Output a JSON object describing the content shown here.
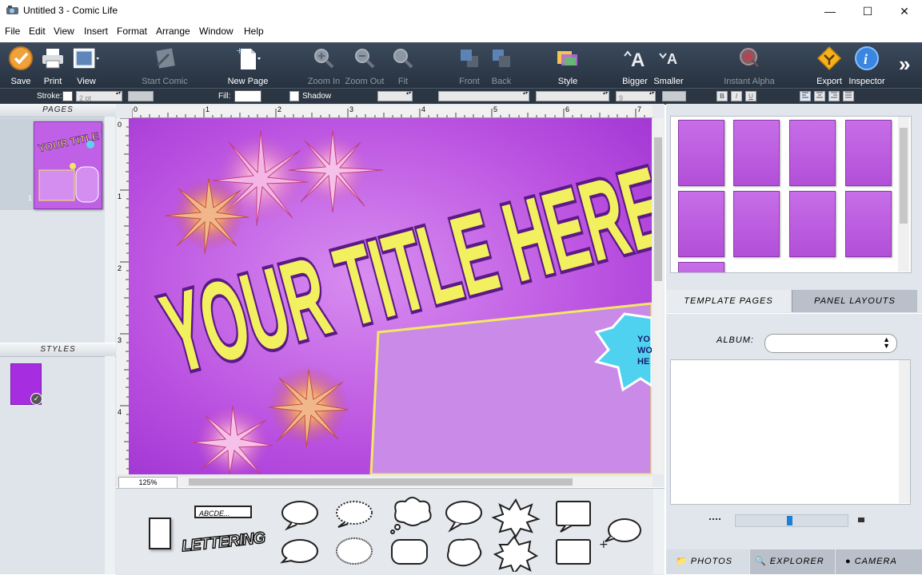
{
  "window": {
    "title": "Untitled 3 - Comic Life",
    "minimize": "—",
    "maximize": "☐",
    "close": "✕"
  },
  "menu": [
    "File",
    "Edit",
    "View",
    "Insert",
    "Format",
    "Arrange",
    "Window",
    "Help"
  ],
  "toolbar": {
    "save": "Save",
    "print": "Print",
    "view": "View",
    "start_comic": "Start Comic",
    "new_page": "New Page",
    "zoom_in": "Zoom In",
    "zoom_out": "Zoom Out",
    "fit": "Fit",
    "front": "Front",
    "back": "Back",
    "style": "Style",
    "bigger": "Bigger",
    "smaller": "Smaller",
    "instant_alpha": "Instant Alpha",
    "export": "Export",
    "inspector": "Inspector",
    "overflow": "»"
  },
  "formatbar": {
    "stroke_label": "Stroke:",
    "stroke_width": "2 pt",
    "fill_label": "Fill:",
    "shadow_label": "Shadow",
    "font_size": "9",
    "bold": "B",
    "italic": "I",
    "underline": "U"
  },
  "pages_panel": {
    "title": "PAGES",
    "page_number": "1"
  },
  "styles_panel": {
    "title": "STYLES"
  },
  "canvas": {
    "title_text": "YOUR TITLE HERE",
    "ruler_h": [
      "0",
      "1",
      "2",
      "3",
      "4",
      "5",
      "6",
      "7"
    ],
    "ruler_v": [
      "0",
      "1",
      "2",
      "3",
      "4"
    ],
    "balloon_text": "YO WO HE",
    "zoom": "125%"
  },
  "balloons_panel": {
    "caption_text": "ABCDE...",
    "lettering_text": "LETTERING"
  },
  "right_panel": {
    "tab_template": "TEMPLATE PAGES",
    "tab_layouts": "PANEL LAYOUTS",
    "album_label": "ALBUM:",
    "tab_photos": "PHOTOS",
    "tab_explorer": "EXPLORER",
    "tab_camera": "CAMERA"
  },
  "colors": {
    "toolbar_bg": "#2e3a48",
    "page_purple": "#b34fdc",
    "title_yellow": "#f3f060",
    "title_outline": "#5b1a87",
    "selection_blue": "#1e7fd8"
  }
}
